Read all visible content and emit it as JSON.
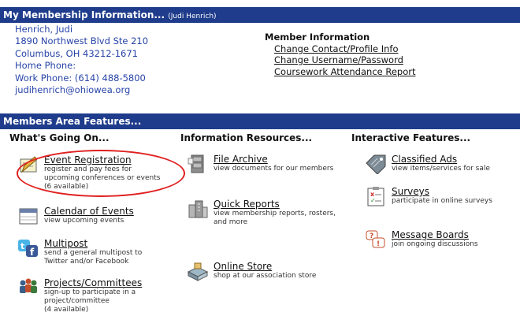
{
  "membership": {
    "title": "My Membership Information...",
    "subtitle": "(Judi Henrich)",
    "name": "Henrich, Judi",
    "street": "1890 Northwest Blvd Ste 210",
    "city": "Columbus, OH 43212-1671",
    "home_phone": "Home Phone:",
    "work_phone": "Work Phone: (614) 488-5800",
    "email": "judihenrich@ohiowea.org"
  },
  "member_info": {
    "heading": "Member Information",
    "links": [
      "Change Contact/Profile Info",
      "Change Username/Password",
      "Coursework Attendance Report"
    ]
  },
  "features_bar": {
    "title": "Members Area Features..."
  },
  "columns": {
    "whats_going_on": {
      "heading": "What's Going On...",
      "items": [
        {
          "title": "Event Registration",
          "desc": [
            "register and pay fees for",
            "upcoming conferences or events",
            "(6 available)"
          ],
          "icon": "pencil-form-icon"
        },
        {
          "title": "Calendar of Events",
          "desc": [
            "view upcoming events"
          ],
          "icon": "calendar-icon"
        },
        {
          "title": "Multipost",
          "desc": [
            "send a general multipost to",
            "Twitter and/or Facebook"
          ],
          "icon": "twitter-facebook-icon"
        },
        {
          "title": "Projects/Committees",
          "desc": [
            "sign-up to participate in a",
            "project/committee",
            "(4 available)"
          ],
          "icon": "people-group-icon"
        }
      ]
    },
    "information_resources": {
      "heading": "Information Resources...",
      "items": [
        {
          "title": "File Archive",
          "desc": [
            "view documents for our members"
          ],
          "icon": "file-cabinet-icon"
        },
        {
          "title": "Quick Reports",
          "desc": [
            "view membership reports, rosters,",
            "and more"
          ],
          "icon": "buildings-icon"
        },
        {
          "title": "Online Store",
          "desc": [
            "shop at our association store"
          ],
          "icon": "store-bag-icon"
        }
      ]
    },
    "interactive_features": {
      "heading": "Interactive Features...",
      "items": [
        {
          "title": "Classified Ads",
          "desc": [
            "view items/services for sale"
          ],
          "icon": "classified-tag-icon"
        },
        {
          "title": "Surveys",
          "desc": [
            "participate in online surveys"
          ],
          "icon": "survey-clipboard-icon"
        },
        {
          "title": "Message Boards",
          "desc": [
            "join ongoing discussions"
          ],
          "icon": "speech-bubbles-icon"
        }
      ]
    }
  },
  "colors": {
    "bar_bg": "#1f3c8c",
    "highlight_ring": "#e02020"
  }
}
